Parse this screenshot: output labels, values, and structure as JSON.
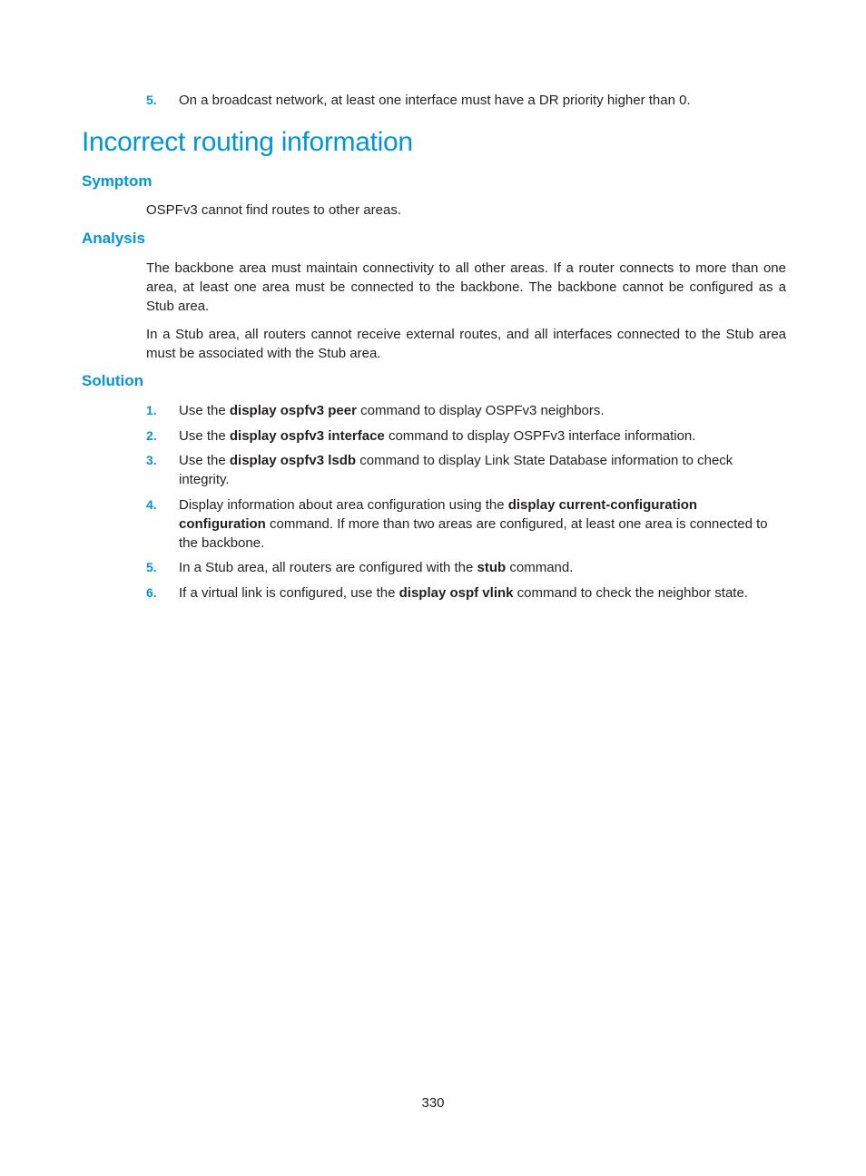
{
  "prev_item": {
    "number": "5.",
    "text": "On a broadcast network, at least one interface must have a DR priority higher than 0."
  },
  "section_title": "Incorrect routing information",
  "symptom": {
    "heading": "Symptom",
    "text": "OSPFv3 cannot find routes to other areas."
  },
  "analysis": {
    "heading": "Analysis",
    "paragraphs": [
      "The backbone area must maintain connectivity to all other areas. If a router connects to more than one area, at least one area must be connected to the backbone. The backbone cannot be configured as a Stub area.",
      "In a Stub area, all routers cannot receive external routes, and all interfaces connected to the Stub area must be associated with the Stub area."
    ]
  },
  "solution": {
    "heading": "Solution",
    "items": [
      {
        "number": "1.",
        "pre": "Use the ",
        "bold": "display ospfv3 peer",
        "post": " command to display OSPFv3 neighbors."
      },
      {
        "number": "2.",
        "pre": "Use the ",
        "bold": "display ospfv3 interface",
        "post": " command to display OSPFv3 interface information."
      },
      {
        "number": "3.",
        "pre": "Use the ",
        "bold": "display ospfv3 lsdb",
        "post": " command to display Link State Database information to check integrity."
      },
      {
        "number": "4.",
        "pre": "Display information about area configuration using the ",
        "bold": "display current-configuration configuration",
        "post": " command. If more than two areas are configured, at least one area is connected to the backbone."
      },
      {
        "number": "5.",
        "pre": "In a Stub area, all routers are configured with the ",
        "bold": "stub",
        "post": " command."
      },
      {
        "number": "6.",
        "pre": "If a virtual link is configured, use the ",
        "bold": "display ospf vlink",
        "post": " command to check the neighbor state."
      }
    ]
  },
  "page_number": "330"
}
